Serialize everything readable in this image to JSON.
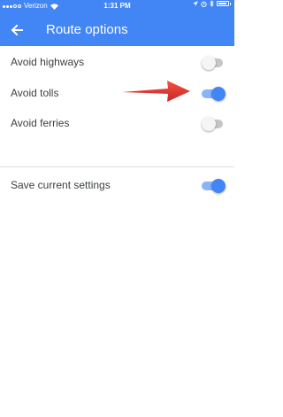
{
  "status_bar": {
    "carrier": "Verizon",
    "time": "1:31 PM",
    "signal_bars": 3,
    "battery_level": 0.85
  },
  "header": {
    "title": "Route options",
    "back_icon": "arrow-back-icon",
    "color": "#4285f4"
  },
  "options": [
    {
      "label": "Avoid highways",
      "on": false
    },
    {
      "label": "Avoid tolls",
      "on": true
    },
    {
      "label": "Avoid ferries",
      "on": false
    }
  ],
  "save_setting": {
    "label": "Save current settings",
    "on": true
  },
  "annotation": {
    "icon": "red-arrow-icon",
    "color": "#e53935"
  }
}
